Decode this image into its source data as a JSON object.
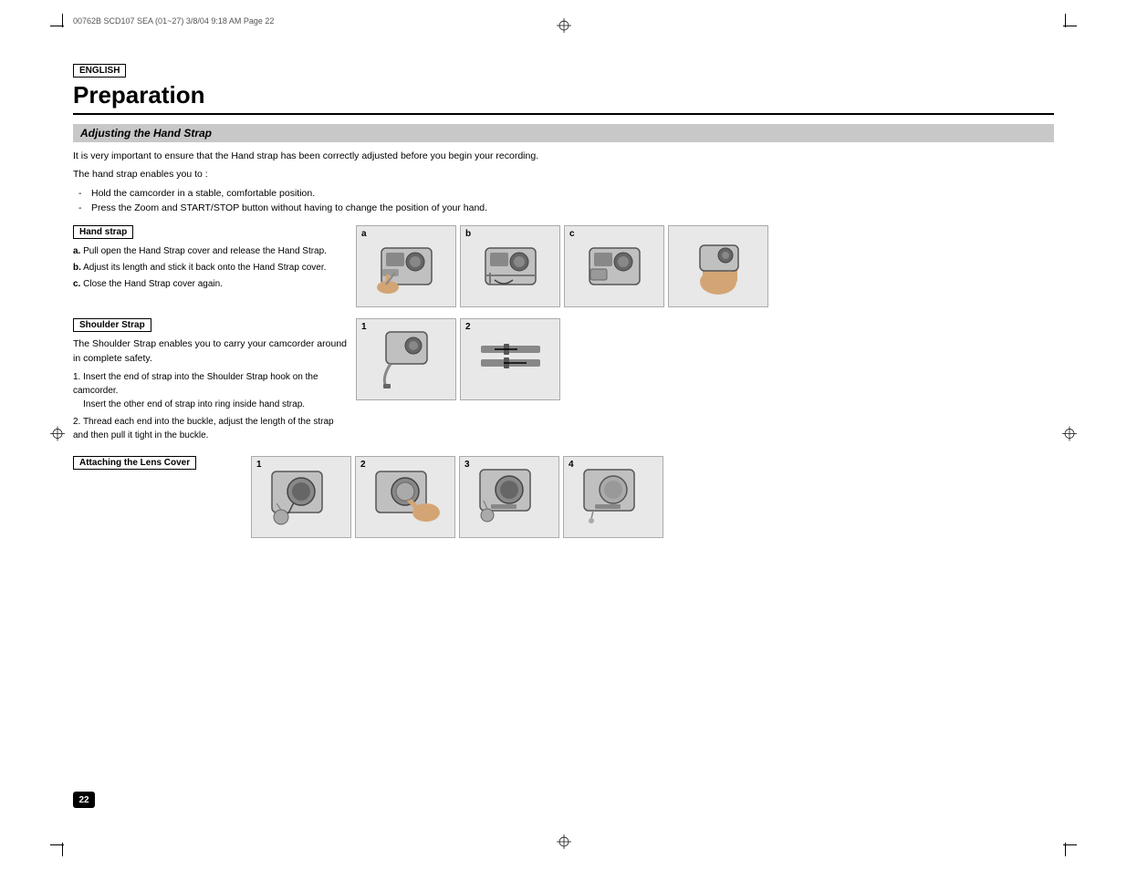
{
  "file_info": "00762B SCD107 SEA (01~27)   3/8/04 9:18 AM   Page 22",
  "english_label": "ENGLISH",
  "page_title": "Preparation",
  "hand_strap_section": {
    "header": "Adjusting the Hand Strap",
    "intro_line1": "It is very important to ensure that the Hand strap has been correctly adjusted before you begin your recording.",
    "intro_line2": "The hand strap enables you to :",
    "bullets": [
      "Hold the camcorder in a stable, comfortable position.",
      "Press the Zoom and START/STOP button without having to change the position of your hand."
    ],
    "sub_label": "Hand strap",
    "steps": [
      {
        "label": "a.",
        "text": "Pull open the Hand Strap cover and release the Hand Strap."
      },
      {
        "label": "b.",
        "text": "Adjust its length and stick it back onto the Hand Strap cover."
      },
      {
        "label": "c.",
        "text": "Close the Hand Strap cover again."
      }
    ],
    "images": [
      {
        "label": "a"
      },
      {
        "label": "b"
      },
      {
        "label": "c"
      },
      {
        "label": ""
      }
    ]
  },
  "shoulder_strap_section": {
    "sub_label": "Shoulder Strap",
    "intro": "The Shoulder Strap enables you to carry your camcorder around in complete safety.",
    "steps": [
      {
        "num": "1.",
        "text": "Insert the end of strap into the Shoulder Strap hook on the camcorder.\n      Insert the other end of strap into ring inside hand strap."
      },
      {
        "num": "2.",
        "text": "Thread each end into the buckle, adjust the length of the strap and then pull it tight in the buckle."
      }
    ],
    "images": [
      {
        "label": "1"
      },
      {
        "label": "2"
      }
    ]
  },
  "lens_cover_section": {
    "sub_label": "Attaching the Lens Cover",
    "images": [
      {
        "label": "1"
      },
      {
        "label": "2"
      },
      {
        "label": "3"
      },
      {
        "label": "4"
      }
    ]
  },
  "page_number": "22"
}
